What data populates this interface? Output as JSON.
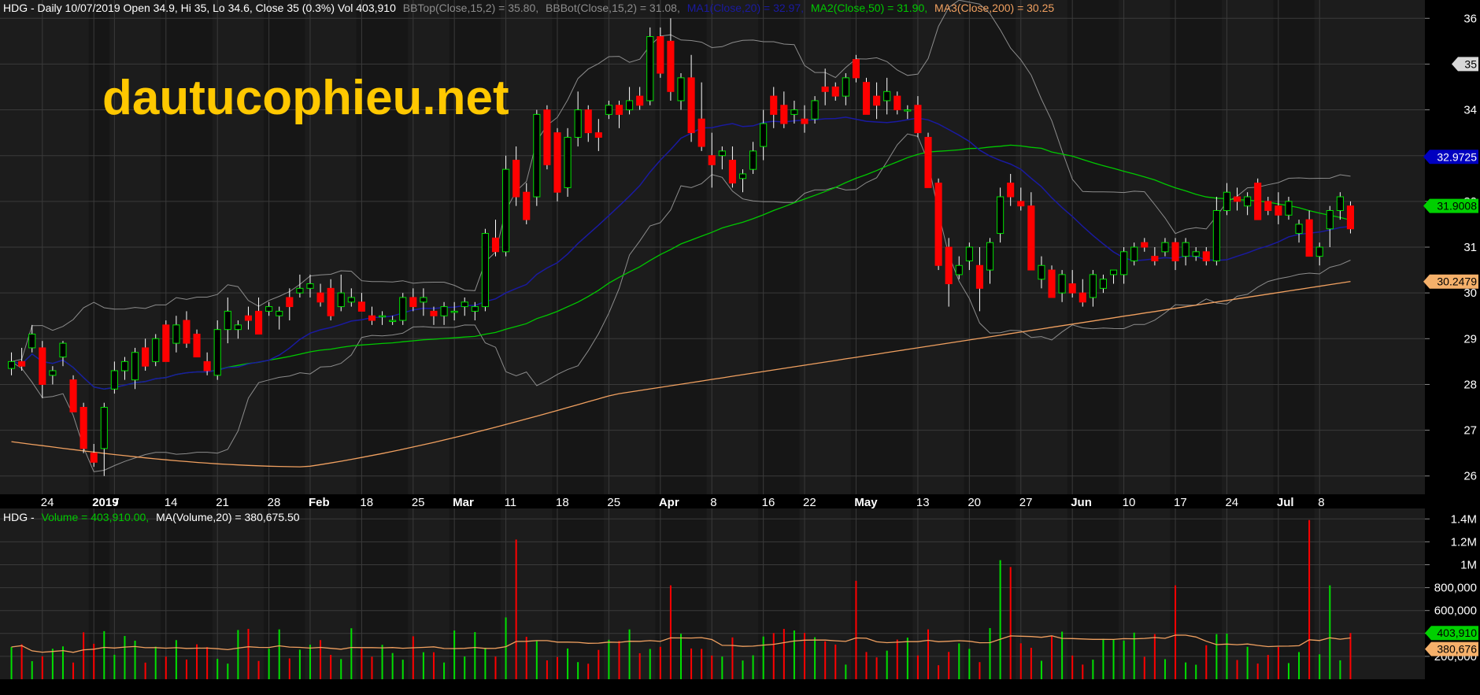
{
  "watermark": "dautucophieu.net",
  "price_header": {
    "prefix": "HDG - Daily 10/07/2019 Open 34.9, Hi 35, Lo 34.6, Close 35 (0.3%) Vol 403,910",
    "bbtop": "BBTop(Close,15,2) = 35.80,",
    "bbbot": "BBBot(Close,15,2) = 31.08,",
    "ma1": "MA1(Close,20) = 32.97,",
    "ma2": "MA2(Close,50) = 31.90,",
    "ma3": "MA3(Close,200) = 30.25"
  },
  "volume_header": {
    "prefix": "HDG -",
    "volume": "Volume = 403,910.00,",
    "ma": "MA(Volume,20) = 380,675.50"
  },
  "colors": {
    "background": "#000000",
    "panel": "#1c1c1c",
    "band_dark": "#161616",
    "grid": "#3a3a3a",
    "up": "#00e000",
    "down": "#ff0000",
    "bollinger": "#8c8c8c",
    "ma1": "#1a1aa0",
    "ma2": "#00c800",
    "ma3": "#f0a060",
    "watermark": "#ffc800"
  },
  "price_tags": [
    {
      "key": "last",
      "text": "35",
      "value": 35,
      "bg": "#d8d8d8",
      "fg": "#000000"
    },
    {
      "key": "ma1",
      "text": "32.9725",
      "value": 32.9725,
      "bg": "#0000c0",
      "fg": "#ffffff"
    },
    {
      "key": "ma2",
      "text": "31.9008",
      "value": 31.9008,
      "bg": "#00d000",
      "fg": "#000000"
    },
    {
      "key": "ma3",
      "text": "30.2479",
      "value": 30.2479,
      "bg": "#f5b06a",
      "fg": "#000000"
    }
  ],
  "volume_tags": [
    {
      "key": "vol",
      "text": "403,910",
      "value": 403910,
      "bg": "#00d000",
      "fg": "#000000"
    },
    {
      "key": "vma",
      "text": "380,676",
      "value": 380676,
      "bg": "#f5b06a",
      "fg": "#000000"
    }
  ],
  "chart_data": {
    "type": "candlestick",
    "ticker": "HDG",
    "price_axis": {
      "min": 25.6,
      "max": 36.4,
      "ticks": [
        26,
        27,
        28,
        29,
        30,
        31,
        32,
        33,
        34,
        35,
        36
      ]
    },
    "volume_axis": {
      "min": 0,
      "max": 1450000,
      "ticks": [
        200000,
        400000,
        600000,
        800000,
        1000000,
        1200000,
        1400000
      ],
      "tick_labels": [
        "200,000",
        "400,000",
        "600,000",
        "800,000",
        "1M",
        "1.2M",
        "1.4M"
      ]
    },
    "x_ticks": [
      {
        "label": "24",
        "i": 3
      },
      {
        "label": "2019",
        "i": 8,
        "bold": true
      },
      {
        "label": "7",
        "i": 10
      },
      {
        "label": "14",
        "i": 15
      },
      {
        "label": "21",
        "i": 20
      },
      {
        "label": "28",
        "i": 25
      },
      {
        "label": "Feb",
        "i": 29,
        "bold": true
      },
      {
        "label": "18",
        "i": 34
      },
      {
        "label": "25",
        "i": 39
      },
      {
        "label": "Mar",
        "i": 43,
        "bold": true
      },
      {
        "label": "11",
        "i": 48
      },
      {
        "label": "18",
        "i": 53
      },
      {
        "label": "25",
        "i": 58
      },
      {
        "label": "Apr",
        "i": 63,
        "bold": true
      },
      {
        "label": "8",
        "i": 68
      },
      {
        "label": "16",
        "i": 73
      },
      {
        "label": "22",
        "i": 77
      },
      {
        "label": "May",
        "i": 82,
        "bold": true
      },
      {
        "label": "13",
        "i": 88
      },
      {
        "label": "20",
        "i": 93
      },
      {
        "label": "27",
        "i": 98
      },
      {
        "label": "Jun",
        "i": 103,
        "bold": true
      },
      {
        "label": "10",
        "i": 108
      },
      {
        "label": "17",
        "i": 113
      },
      {
        "label": "24",
        "i": 118
      },
      {
        "label": "Jul",
        "i": 123,
        "bold": true
      },
      {
        "label": "8",
        "i": 127
      }
    ],
    "candles": [
      [
        28.35,
        28.7,
        28.2,
        28.5
      ],
      [
        28.5,
        28.8,
        28.3,
        28.4
      ],
      [
        28.8,
        29.3,
        28.7,
        29.1
      ],
      [
        28.8,
        28.95,
        27.7,
        28.0
      ],
      [
        28.2,
        28.4,
        28.0,
        28.3
      ],
      [
        28.6,
        28.95,
        28.4,
        28.9
      ],
      [
        28.1,
        28.2,
        27.4,
        27.4
      ],
      [
        27.5,
        27.6,
        26.5,
        26.6
      ],
      [
        26.5,
        26.7,
        26.2,
        26.3
      ],
      [
        26.6,
        27.6,
        26.0,
        27.5
      ],
      [
        27.9,
        28.5,
        27.8,
        28.3
      ],
      [
        28.3,
        28.6,
        28.1,
        28.5
      ],
      [
        28.1,
        28.8,
        27.9,
        28.7
      ],
      [
        28.8,
        29.0,
        28.3,
        28.4
      ],
      [
        28.5,
        29.1,
        28.4,
        29.0
      ],
      [
        29.3,
        29.4,
        28.5,
        28.5
      ],
      [
        28.9,
        29.5,
        28.7,
        29.3
      ],
      [
        29.4,
        29.6,
        28.8,
        28.9
      ],
      [
        29.1,
        29.2,
        28.6,
        28.6
      ],
      [
        28.5,
        28.7,
        28.2,
        28.3
      ],
      [
        28.2,
        29.4,
        28.1,
        29.2
      ],
      [
        29.2,
        29.9,
        28.9,
        29.6
      ],
      [
        29.2,
        29.4,
        29.0,
        29.3
      ],
      [
        29.5,
        29.7,
        29.2,
        29.4
      ],
      [
        29.6,
        29.9,
        29.1,
        29.1
      ],
      [
        29.6,
        29.8,
        29.5,
        29.7
      ],
      [
        29.5,
        29.7,
        29.2,
        29.6
      ],
      [
        29.9,
        30.1,
        29.4,
        29.7
      ],
      [
        30.0,
        30.4,
        29.9,
        30.1
      ],
      [
        30.1,
        30.4,
        29.9,
        30.2
      ],
      [
        30.0,
        30.2,
        29.7,
        29.8
      ],
      [
        30.1,
        30.3,
        29.4,
        29.5
      ],
      [
        29.7,
        30.4,
        29.6,
        30.0
      ],
      [
        29.8,
        30.1,
        29.7,
        29.9
      ],
      [
        29.8,
        30.0,
        29.6,
        29.6
      ],
      [
        29.5,
        29.7,
        29.3,
        29.4
      ],
      [
        29.5,
        29.6,
        29.3,
        29.5
      ],
      [
        29.4,
        29.5,
        29.3,
        29.4
      ],
      [
        29.4,
        30.0,
        29.3,
        29.9
      ],
      [
        29.9,
        30.1,
        29.6,
        29.7
      ],
      [
        29.8,
        30.1,
        29.5,
        29.9
      ],
      [
        29.6,
        29.7,
        29.3,
        29.5
      ],
      [
        29.5,
        29.8,
        29.3,
        29.7
      ],
      [
        29.6,
        29.8,
        29.4,
        29.6
      ],
      [
        29.7,
        29.9,
        29.5,
        29.8
      ],
      [
        29.6,
        29.8,
        29.4,
        29.7
      ],
      [
        29.7,
        31.4,
        29.6,
        31.3
      ],
      [
        31.2,
        31.6,
        30.8,
        30.9
      ],
      [
        30.9,
        33.0,
        30.8,
        32.7
      ],
      [
        32.9,
        33.2,
        31.9,
        32.1
      ],
      [
        32.2,
        32.4,
        31.5,
        31.6
      ],
      [
        32.1,
        34.0,
        31.9,
        33.9
      ],
      [
        34.0,
        34.1,
        32.7,
        32.8
      ],
      [
        33.5,
        33.6,
        32.0,
        32.2
      ],
      [
        32.3,
        33.6,
        32.1,
        33.4
      ],
      [
        33.4,
        34.4,
        33.2,
        34.0
      ],
      [
        34.0,
        34.1,
        33.3,
        33.5
      ],
      [
        33.5,
        33.8,
        33.1,
        33.4
      ],
      [
        33.9,
        34.2,
        33.8,
        34.1
      ],
      [
        34.1,
        34.2,
        33.6,
        33.9
      ],
      [
        34.0,
        34.5,
        33.9,
        34.2
      ],
      [
        34.3,
        34.5,
        34.0,
        34.1
      ],
      [
        34.2,
        35.8,
        34.1,
        35.6
      ],
      [
        35.6,
        35.8,
        34.7,
        34.8
      ],
      [
        35.5,
        36.0,
        34.2,
        34.4
      ],
      [
        34.2,
        34.8,
        34.0,
        34.7
      ],
      [
        34.7,
        35.2,
        33.3,
        33.5
      ],
      [
        33.8,
        34.6,
        33.1,
        33.2
      ],
      [
        33.0,
        33.5,
        32.3,
        32.8
      ],
      [
        33.0,
        33.2,
        32.7,
        33.1
      ],
      [
        32.9,
        33.2,
        32.3,
        32.4
      ],
      [
        32.5,
        32.7,
        32.2,
        32.6
      ],
      [
        32.7,
        33.3,
        32.6,
        33.1
      ],
      [
        33.2,
        34.0,
        32.9,
        33.7
      ],
      [
        34.3,
        34.5,
        33.6,
        33.9
      ],
      [
        34.1,
        34.4,
        33.6,
        33.7
      ],
      [
        33.9,
        34.2,
        33.7,
        34.0
      ],
      [
        33.8,
        34.1,
        33.5,
        33.7
      ],
      [
        33.8,
        34.3,
        33.7,
        34.2
      ],
      [
        34.5,
        34.9,
        34.1,
        34.4
      ],
      [
        34.5,
        34.6,
        34.2,
        34.3
      ],
      [
        34.3,
        34.8,
        34.1,
        34.7
      ],
      [
        35.1,
        35.2,
        34.6,
        34.7
      ],
      [
        34.6,
        34.7,
        33.9,
        33.9
      ],
      [
        34.3,
        34.6,
        33.8,
        34.1
      ],
      [
        34.2,
        34.7,
        33.9,
        34.4
      ],
      [
        34.3,
        34.4,
        33.9,
        34.0
      ],
      [
        34.0,
        34.1,
        33.8,
        34.0
      ],
      [
        34.1,
        34.3,
        33.4,
        33.5
      ],
      [
        33.4,
        33.5,
        32.3,
        32.3
      ],
      [
        32.4,
        32.5,
        30.5,
        30.6
      ],
      [
        31.0,
        31.2,
        29.7,
        30.2
      ],
      [
        30.4,
        30.8,
        30.3,
        30.6
      ],
      [
        30.7,
        31.1,
        30.5,
        31.0
      ],
      [
        30.6,
        31.0,
        29.6,
        30.1
      ],
      [
        30.5,
        31.2,
        30.2,
        31.1
      ],
      [
        31.3,
        32.3,
        31.1,
        32.1
      ],
      [
        32.4,
        32.6,
        31.9,
        32.1
      ],
      [
        32.0,
        32.3,
        31.8,
        31.9
      ],
      [
        31.9,
        32.2,
        30.5,
        30.5
      ],
      [
        30.3,
        30.8,
        30.1,
        30.6
      ],
      [
        30.5,
        30.6,
        29.9,
        29.9
      ],
      [
        30.0,
        30.5,
        29.8,
        30.4
      ],
      [
        30.2,
        30.5,
        29.9,
        30.0
      ],
      [
        30.0,
        30.3,
        29.7,
        29.8
      ],
      [
        29.9,
        30.5,
        29.7,
        30.4
      ],
      [
        30.1,
        30.4,
        30.0,
        30.3
      ],
      [
        30.4,
        30.5,
        30.2,
        30.5
      ],
      [
        30.4,
        31.0,
        30.2,
        30.9
      ],
      [
        30.7,
        31.1,
        30.6,
        31.0
      ],
      [
        31.1,
        31.2,
        30.9,
        31.0
      ],
      [
        30.8,
        31.0,
        30.6,
        30.7
      ],
      [
        30.9,
        31.2,
        30.8,
        31.1
      ],
      [
        31.1,
        31.2,
        30.5,
        30.7
      ],
      [
        30.8,
        31.2,
        30.6,
        31.1
      ],
      [
        30.8,
        31.0,
        30.7,
        30.9
      ],
      [
        30.9,
        31.0,
        30.6,
        30.7
      ],
      [
        30.7,
        32.1,
        30.6,
        31.8
      ],
      [
        31.8,
        32.4,
        31.7,
        32.2
      ],
      [
        32.1,
        32.3,
        31.8,
        32.0
      ],
      [
        31.9,
        32.2,
        31.7,
        32.1
      ],
      [
        32.4,
        32.5,
        31.6,
        31.6
      ],
      [
        32.0,
        32.1,
        31.7,
        31.8
      ],
      [
        31.9,
        32.2,
        31.5,
        31.7
      ],
      [
        31.7,
        32.1,
        31.6,
        32.0
      ],
      [
        31.3,
        31.6,
        31.1,
        31.5
      ],
      [
        31.6,
        31.8,
        30.8,
        30.8
      ],
      [
        30.8,
        31.1,
        30.6,
        31.0
      ],
      [
        31.4,
        31.9,
        31.0,
        31.8
      ],
      [
        31.8,
        32.2,
        31.6,
        32.1
      ],
      [
        31.9,
        32.0,
        31.3,
        31.4
      ]
    ],
    "volume": [],
    "overlays": {
      "bb_top": [],
      "bb_bot": [],
      "ma20": [],
      "ma50": [],
      "ma200": [],
      "vol_ma20": []
    }
  }
}
